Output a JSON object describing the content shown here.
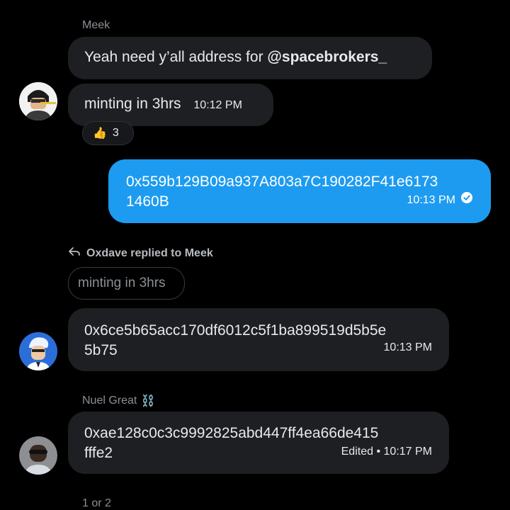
{
  "messages": {
    "meek": {
      "sender": "Meek",
      "text1_prefix": "Yeah need y’all address for ",
      "text1_mention": "@spacebrokers_",
      "text2": "minting in 3hrs",
      "time": "10:12 PM",
      "reaction": {
        "emoji": "👍",
        "count": "3"
      }
    },
    "own": {
      "text_line1": "0x559b129B09a937A803a7C190282F41e6173",
      "text_line2": "1460B",
      "time": "10:13 PM"
    },
    "oxdave": {
      "reply_label": "Oxdave replied to Meek",
      "quoted": "minting in 3hrs",
      "text_line1": "0x6ce5b65acc170df6012c5f1ba899519d5b5e",
      "text_line2": "5b75",
      "time": "10:13 PM"
    },
    "nuel": {
      "sender": "Nuel Great",
      "sender_emoji": "⛓️",
      "text_line1": "0xae128c0c3c9992825abd447ff4ea66de415",
      "text_line2": "fffe2",
      "edited": "Edited",
      "time": "10:17 PM"
    }
  },
  "footer": {
    "sender": "1 or 2"
  },
  "colors": {
    "outgoing": "#1d9bf0",
    "incoming": "#1e1f22",
    "background": "#000000"
  }
}
